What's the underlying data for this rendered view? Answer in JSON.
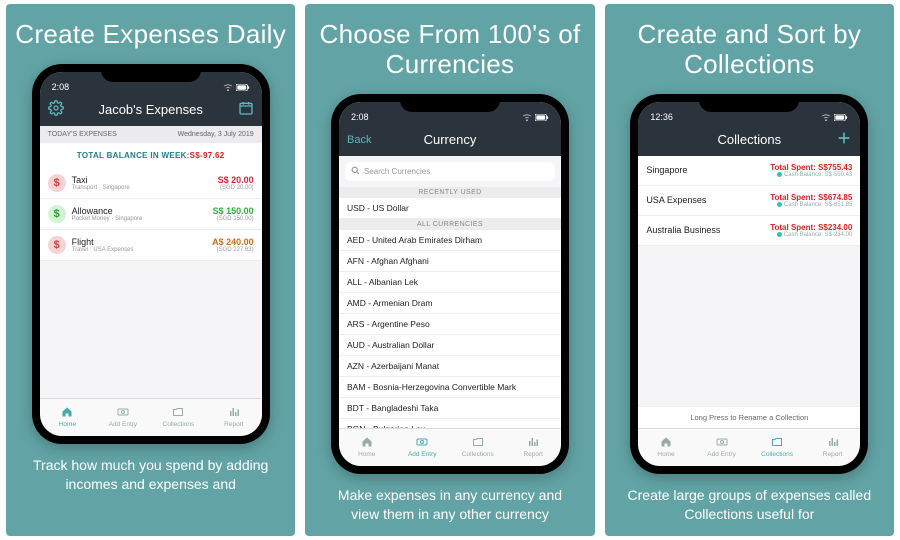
{
  "panels": [
    {
      "title": "Create Expenses Daily",
      "caption": "Track how much you spend by adding incomes and expenses and"
    },
    {
      "title": "Choose From 100's of Currencies",
      "caption": "Make expenses in any currency and view them in any other currency"
    },
    {
      "title": "Create and Sort by Collections",
      "caption": "Create large groups of expenses called Collections useful for"
    }
  ],
  "status_time_1": "2:08",
  "status_time_2": "2:08",
  "status_time_3": "12:36",
  "s1": {
    "header_title": "Jacob's Expenses",
    "today_label": "TODAY'S EXPENSES",
    "today_date": "Wednesday, 3 July 2019",
    "balance_label": "TOTAL BALANCE IN WEEK:",
    "balance_value": "S$-97.62",
    "rows": [
      {
        "title": "Taxi",
        "sub": "Transport · Singapore",
        "amount": "S$ 20.00",
        "conv": "(SGD 20.00)",
        "coin": "red",
        "amt_class": "red"
      },
      {
        "title": "Allowance",
        "sub": "Pocket Money · Singapore",
        "amount": "S$ 150.00",
        "conv": "(SGD 150.00)",
        "coin": "green",
        "amt_class": "green"
      },
      {
        "title": "Flight",
        "sub": "Travel · USA Expenses",
        "amount": "A$ 240.00",
        "conv": "(SGD 227.63)",
        "coin": "red",
        "amt_class": "orange"
      }
    ]
  },
  "s2": {
    "back_label": "Back",
    "header_title": "Currency",
    "search_placeholder": "Search Currencies",
    "section_recent": "RECENTLY USED",
    "section_all": "ALL CURRENCIES",
    "recent": [
      "USD - US Dollar"
    ],
    "all": [
      "AED - United Arab Emirates Dirham",
      "AFN - Afghan Afghani",
      "ALL - Albanian Lek",
      "AMD - Armenian Dram",
      "ARS - Argentine Peso",
      "AUD - Australian Dollar",
      "AZN - Azerbaijani Manat",
      "BAM - Bosnia-Herzegovina Convertible Mark",
      "BDT - Bangladeshi Taka",
      "BGN - Bulgarian Lev"
    ]
  },
  "s3": {
    "header_title": "Collections",
    "rows": [
      {
        "name": "Singapore",
        "total": "Total Spent: S$755.43",
        "cash": "Cash Balance: S$-550.43"
      },
      {
        "name": "USA Expenses",
        "total": "Total Spent: S$674.85",
        "cash": "Cash Balance: S$-651.85"
      },
      {
        "name": "Australia Business",
        "total": "Total Spent: S$234.00",
        "cash": "Cash Balance: S$-234.00"
      }
    ],
    "footer_note": "Long Press to Rename a Collection"
  },
  "tabs": [
    "Home",
    "Add Entry",
    "Collections",
    "Report"
  ]
}
